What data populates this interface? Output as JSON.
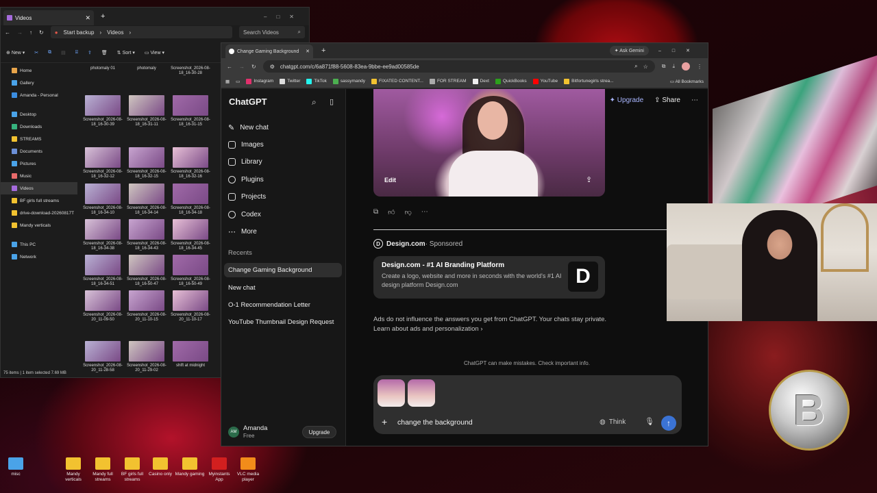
{
  "explorer": {
    "tab_title": "Videos",
    "backup": "Start backup",
    "crumb": "Videos",
    "search_placeholder": "Search Videos",
    "toolbar": {
      "new": "New",
      "sort": "Sort",
      "view": "View"
    },
    "sidebar": [
      "Home",
      "Gallery",
      "Amanda - Personal",
      "Desktop",
      "Downloads",
      "STREAMS",
      "Documents",
      "Pictures",
      "Music",
      "Videos",
      "BF girls full streams",
      "drive-download-20260817T",
      "Mandy verticals",
      "This PC",
      "Network"
    ],
    "files": [
      "photomaly 01",
      "photomaly",
      "Screenshot_2026-08-18_16-30-28",
      "Screenshot_2026-08-18_16-30-39",
      "Screenshot_2026-08-18_16-31-11",
      "Screenshot_2026-08-18_16-31-15",
      "Screenshot_2026-08-18_16-32-12",
      "Screenshot_2026-08-18_16-32-15",
      "Screenshot_2026-08-18_16-32-16",
      "Screenshot_2026-08-18_16-34-10",
      "Screenshot_2026-08-18_16-34-14",
      "Screenshot_2026-08-18_16-34-18",
      "Screenshot_2026-08-18_16-34-38",
      "Screenshot_2026-08-18_16-34-43",
      "Screenshot_2026-08-18_16-34-45",
      "Screenshot_2026-08-18_16-34-51",
      "Screenshot_2026-08-18_16-50-47",
      "Screenshot_2026-08-18_16-50-49",
      "Screenshot_2026-08-20_11-09-50",
      "Screenshot_2026-08-20_11-10-15",
      "Screenshot_2026-08-20_11-10-17",
      "Screenshot_2026-08-20_11-28-58",
      "Screenshot_2026-08-20_11-29-02",
      "shift at midnight"
    ],
    "status": "75 items  |  1 item selected  7.69 MB"
  },
  "browser": {
    "tab_title": "Change Gaming Background",
    "url": "chatgpt.com/c/6a871f88-5608-83ea-9bbe-ee9ad00585de",
    "ask": "Ask Gemini",
    "bookmarks": [
      "Instagram",
      "Twitter",
      "TikTok",
      "sassymandy",
      "FIXATED CONTENT...",
      "FOR STREAM",
      "Dext",
      "QuickBooks",
      "YouTube",
      "Bitfortunegirls strea..."
    ],
    "all_bookmarks": "All Bookmarks"
  },
  "chatgpt": {
    "logo": "ChatGPT",
    "nav": [
      "New chat",
      "Images",
      "Library",
      "Plugins",
      "Projects",
      "Codex",
      "More"
    ],
    "recents_label": "Recents",
    "recents": [
      "Change Gaming Background",
      "New chat",
      "O-1 Recommendation Letter",
      "YouTube Thumbnail Design Request"
    ],
    "user_name": "Amanda",
    "user_plan": "Free",
    "user_initials": "AM",
    "upgrade_small": "Upgrade",
    "top_upgrade": "Upgrade",
    "top_share": "Share",
    "edit": "Edit",
    "sponsor_name": "Design.com",
    "sponsor_suffix": " · Sponsored",
    "ad_title": "Design.com - #1 AI Branding Platform",
    "ad_desc": "Create a logo, website and more in seconds with the world's #1 AI design platform Design.com",
    "ad_note1": "Ads do not influence the answers you get from ChatGPT. Your chats stay private.",
    "ad_note2": "Learn about ads and personalization ›",
    "disclaimer": "ChatGPT can make mistakes. Check important info.",
    "composer_text": "change the background",
    "think": "Think"
  },
  "desktop_icons": [
    "misc",
    "Mandy verticals",
    "Mandy full streams",
    "BF girls full streams",
    "Casino only",
    "Mandy gaming",
    "Myinstants App",
    "VLC media player"
  ]
}
